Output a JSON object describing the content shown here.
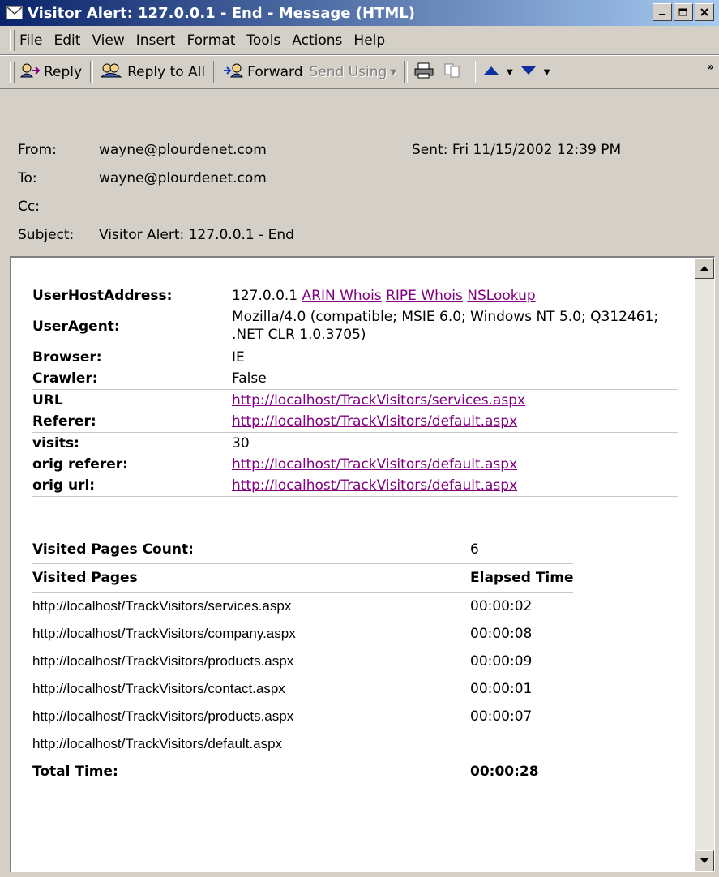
{
  "window": {
    "title": "Visitor Alert: 127.0.0.1 - End - Message (HTML)"
  },
  "menu": {
    "items": [
      {
        "label": "File"
      },
      {
        "label": "Edit"
      },
      {
        "label": "View"
      },
      {
        "label": "Insert"
      },
      {
        "label": "Format"
      },
      {
        "label": "Tools"
      },
      {
        "label": "Actions"
      },
      {
        "label": "Help"
      }
    ]
  },
  "toolbar": {
    "reply_label": "Reply",
    "reply_all_label": "Reply to All",
    "forward_label": "Forward",
    "send_using_label": "Send Using",
    "more_label": "»"
  },
  "message": {
    "from_label": "From:",
    "from_value": "wayne@plourdenet.com",
    "to_label": "To:",
    "to_value": "wayne@plourdenet.com",
    "cc_label": "Cc:",
    "cc_value": "",
    "subject_label": "Subject:",
    "subject_value": "Visitor Alert: 127.0.0.1 - End",
    "sent_label": "Sent:",
    "sent_value": "Fri 11/15/2002 12:39 PM"
  },
  "body": {
    "info": {
      "host_label": "UserHostAddress:",
      "host_value": "127.0.0.1",
      "arin_link": "ARIN Whois",
      "ripe_link": "RIPE Whois",
      "nslookup_link": "NSLookup",
      "agent_label": "UserAgent:",
      "agent_value": "Mozilla/4.0 (compatible; MSIE 6.0; Windows NT 5.0; Q312461; .NET CLR 1.0.3705)",
      "browser_label": "Browser:",
      "browser_value": "IE",
      "crawler_label": "Crawler:",
      "crawler_value": "False",
      "url_label": "URL",
      "url_value": "http://localhost/TrackVisitors/services.aspx",
      "referer_label": "Referer:",
      "referer_value": "http://localhost/TrackVisitors/default.aspx",
      "visits_label": "visits:",
      "visits_value": "30",
      "orig_referer_label": "orig referer:",
      "orig_referer_value": "http://localhost/TrackVisitors/default.aspx",
      "orig_url_label": "orig url:",
      "orig_url_value": "http://localhost/TrackVisitors/default.aspx"
    },
    "pages": {
      "count_label": "Visited Pages Count:",
      "count_value": "6",
      "col_pages": "Visited Pages",
      "col_elapsed": "Elapsed Time",
      "rows": [
        {
          "url": "http://localhost/TrackVisitors/services.aspx",
          "time": "00:00:02"
        },
        {
          "url": "http://localhost/TrackVisitors/company.aspx",
          "time": "00:00:08"
        },
        {
          "url": "http://localhost/TrackVisitors/products.aspx",
          "time": "00:00:09"
        },
        {
          "url": "http://localhost/TrackVisitors/contact.aspx",
          "time": "00:00:01"
        },
        {
          "url": "http://localhost/TrackVisitors/products.aspx",
          "time": "00:00:07"
        },
        {
          "url": "http://localhost/TrackVisitors/default.aspx",
          "time": ""
        }
      ],
      "total_label": "Total Time:",
      "total_value": "00:00:28"
    }
  }
}
